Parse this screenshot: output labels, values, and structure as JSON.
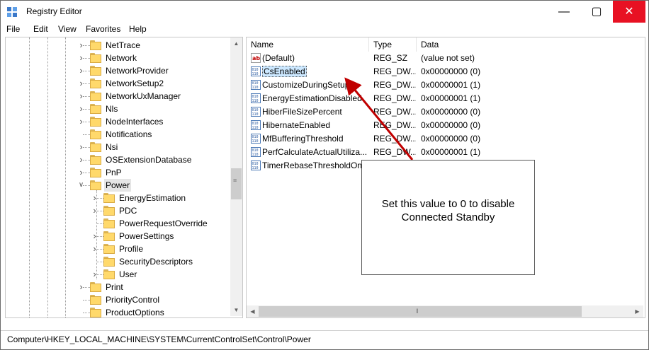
{
  "window": {
    "title": "Registry Editor"
  },
  "menu": [
    "File",
    "Edit",
    "View",
    "Favorites",
    "Help"
  ],
  "tree": [
    {
      "label": "NetTrace",
      "level": 1,
      "expandable": true
    },
    {
      "label": "Network",
      "level": 1,
      "expandable": true
    },
    {
      "label": "NetworkProvider",
      "level": 1,
      "expandable": true
    },
    {
      "label": "NetworkSetup2",
      "level": 1,
      "expandable": true
    },
    {
      "label": "NetworkUxManager",
      "level": 1,
      "expandable": true
    },
    {
      "label": "Nls",
      "level": 1,
      "expandable": true
    },
    {
      "label": "NodeInterfaces",
      "level": 1,
      "expandable": true
    },
    {
      "label": "Notifications",
      "level": 1,
      "expandable": false
    },
    {
      "label": "Nsi",
      "level": 1,
      "expandable": true
    },
    {
      "label": "OSExtensionDatabase",
      "level": 1,
      "expandable": true
    },
    {
      "label": "PnP",
      "level": 1,
      "expandable": true
    },
    {
      "label": "Power",
      "level": 1,
      "expandable": true,
      "expanded": true,
      "selected": true
    },
    {
      "label": "EnergyEstimation",
      "level": 2,
      "expandable": true
    },
    {
      "label": "PDC",
      "level": 2,
      "expandable": true
    },
    {
      "label": "PowerRequestOverride",
      "level": 2,
      "expandable": false
    },
    {
      "label": "PowerSettings",
      "level": 2,
      "expandable": true
    },
    {
      "label": "Profile",
      "level": 2,
      "expandable": true
    },
    {
      "label": "SecurityDescriptors",
      "level": 2,
      "expandable": false
    },
    {
      "label": "User",
      "level": 2,
      "expandable": true
    },
    {
      "label": "Print",
      "level": 1,
      "expandable": true
    },
    {
      "label": "PriorityControl",
      "level": 1,
      "expandable": false
    },
    {
      "label": "ProductOptions",
      "level": 1,
      "expandable": false
    }
  ],
  "list": {
    "columns": [
      "Name",
      "Type",
      "Data"
    ],
    "rows": [
      {
        "name": "(Default)",
        "type": "REG_SZ",
        "data": "(value not set)",
        "icon": "string-value-icon"
      },
      {
        "name": "CsEnabled",
        "type": "REG_DW...",
        "data": "0x00000000 (0)",
        "icon": "dword-value-icon",
        "selected": true
      },
      {
        "name": "CustomizeDuringSetup",
        "type": "REG_DW...",
        "data": "0x00000001 (1)",
        "icon": "dword-value-icon"
      },
      {
        "name": "EnergyEstimationDisabled",
        "type": "REG_DW...",
        "data": "0x00000001 (1)",
        "icon": "dword-value-icon"
      },
      {
        "name": "HiberFileSizePercent",
        "type": "REG_DW...",
        "data": "0x00000000 (0)",
        "icon": "dword-value-icon"
      },
      {
        "name": "HibernateEnabled",
        "type": "REG_DW...",
        "data": "0x00000000 (0)",
        "icon": "dword-value-icon"
      },
      {
        "name": "MfBufferingThreshold",
        "type": "REG_DW...",
        "data": "0x00000000 (0)",
        "icon": "dword-value-icon"
      },
      {
        "name": "PerfCalculateActualUtiliza...",
        "type": "REG_DW...",
        "data": "0x00000001 (1)",
        "icon": "dword-value-icon"
      },
      {
        "name": "TimerRebaseThresholdOn...",
        "type": "",
        "data": "",
        "icon": "dword-value-icon"
      }
    ]
  },
  "annotation": {
    "line1": "Set this value to 0 to disable",
    "line2": "Connected Standby",
    "arrow_color": "#c00000"
  },
  "statusbar": {
    "path": "Computer\\HKEY_LOCAL_MACHINE\\SYSTEM\\CurrentControlSet\\Control\\Power"
  }
}
